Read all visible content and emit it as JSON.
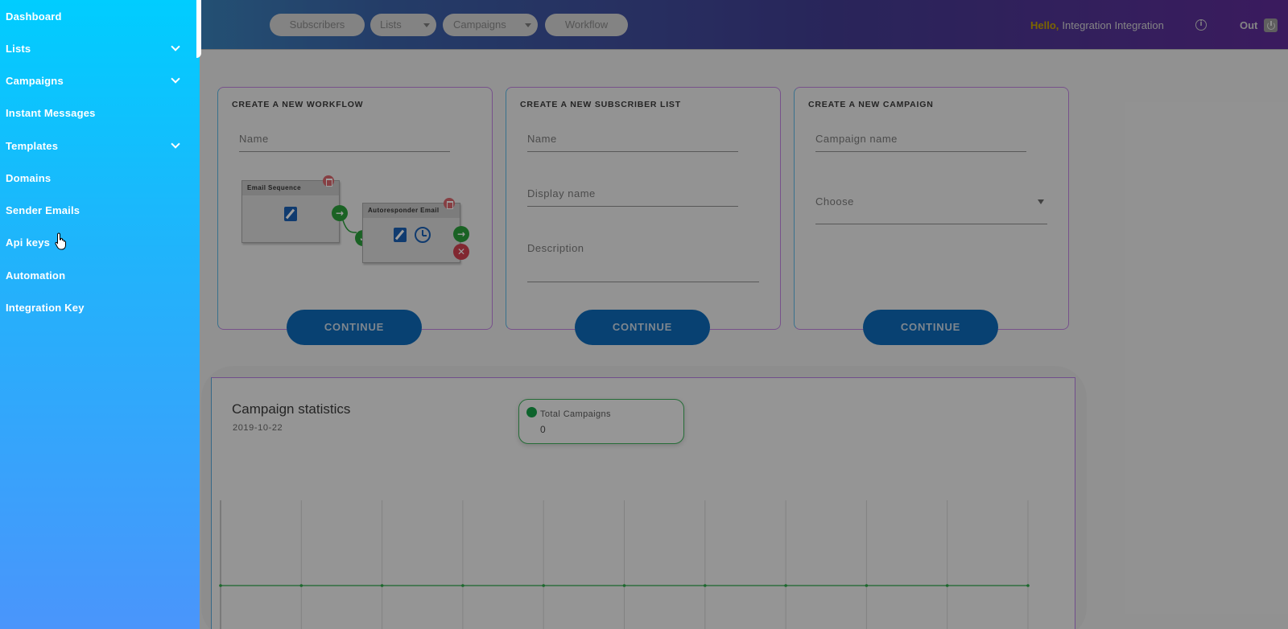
{
  "sidebar": {
    "items": [
      {
        "label": "Dashboard"
      },
      {
        "label": "Lists"
      },
      {
        "label": "Campaigns"
      },
      {
        "label": "Instant Messages"
      },
      {
        "label": "Templates"
      },
      {
        "label": "Domains"
      },
      {
        "label": "Sender Emails"
      },
      {
        "label": "Api keys"
      },
      {
        "label": "Automation"
      },
      {
        "label": "Integration Key"
      }
    ]
  },
  "topbar": {
    "nav": [
      {
        "label": "Subscribers"
      },
      {
        "label": "Lists"
      },
      {
        "label": "Campaigns"
      },
      {
        "label": "Workflow"
      }
    ],
    "hello": "Hello,",
    "user_name": "Integration Integration",
    "logout_label": "Out"
  },
  "cards": {
    "workflow": {
      "title": "CREATE A NEW WORKFLOW",
      "name_placeholder": "Name",
      "node1_title": "Email Sequence",
      "node2_title": "Autoresponder Email",
      "continue_label": "CONTINUE"
    },
    "subscriber_list": {
      "title": "CREATE A NEW SUBSCRIBER LIST",
      "name_placeholder": "Name",
      "display_name_placeholder": "Display name",
      "description_placeholder": "Description",
      "continue_label": "CONTINUE"
    },
    "campaign": {
      "title": "CREATE A NEW CAMPAIGN",
      "name_placeholder": "Campaign name",
      "choose_placeholder": "Choose",
      "continue_label": "CONTINUE"
    }
  },
  "statistics": {
    "title": "Campaign statistics",
    "date": "2019-10-22",
    "total_label": "Total Campaigns",
    "total_value": "0"
  },
  "colors": {
    "sidebar_top": "#00cdff",
    "sidebar_bottom": "#4a95fb",
    "primary_button": "#0d6ab8",
    "series_line": "#2ea84a"
  },
  "chart_data": {
    "type": "line",
    "title": "Campaign statistics",
    "x_points": 11,
    "series": [
      {
        "name": "Total Campaigns",
        "values": [
          0,
          0,
          0,
          0,
          0,
          0,
          0,
          0,
          0,
          0,
          0
        ]
      }
    ],
    "grid": true
  }
}
